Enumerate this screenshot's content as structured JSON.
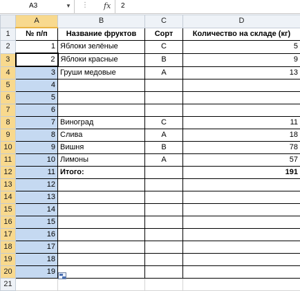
{
  "formula_bar": {
    "name_box": "A3",
    "fx": "fx",
    "formula": "2"
  },
  "columns": [
    "A",
    "B",
    "C",
    "D"
  ],
  "rows": [
    {
      "num": "1",
      "a": "№ п/п",
      "b": "Название фруктов",
      "c": "Сорт",
      "d": "Количество на складе (кг)"
    },
    {
      "num": "2",
      "a": "1",
      "b": "Яблоки зелёные",
      "c": "C",
      "d": "5"
    },
    {
      "num": "3",
      "a": "2",
      "b": "Яблоки красные",
      "c": "B",
      "d": "9"
    },
    {
      "num": "4",
      "a": "3",
      "b": "Груши медовые",
      "c": "A",
      "d": "13"
    },
    {
      "num": "5",
      "a": "4",
      "b": "",
      "c": "",
      "d": ""
    },
    {
      "num": "6",
      "a": "5",
      "b": "",
      "c": "",
      "d": ""
    },
    {
      "num": "7",
      "a": "6",
      "b": "",
      "c": "",
      "d": ""
    },
    {
      "num": "8",
      "a": "7",
      "b": "Виноград",
      "c": "C",
      "d": "11"
    },
    {
      "num": "9",
      "a": "8",
      "b": "Слива",
      "c": "A",
      "d": "18"
    },
    {
      "num": "10",
      "a": "9",
      "b": "Вишня",
      "c": "B",
      "d": "78"
    },
    {
      "num": "11",
      "a": "10",
      "b": "Лимоны",
      "c": "A",
      "d": "57"
    },
    {
      "num": "12",
      "a": "11",
      "b": "Итого:",
      "c": "",
      "d": "191"
    },
    {
      "num": "13",
      "a": "12",
      "b": "",
      "c": "",
      "d": ""
    },
    {
      "num": "14",
      "a": "13",
      "b": "",
      "c": "",
      "d": ""
    },
    {
      "num": "15",
      "a": "14",
      "b": "",
      "c": "",
      "d": ""
    },
    {
      "num": "16",
      "a": "15",
      "b": "",
      "c": "",
      "d": ""
    },
    {
      "num": "17",
      "a": "16",
      "b": "",
      "c": "",
      "d": ""
    },
    {
      "num": "18",
      "a": "17",
      "b": "",
      "c": "",
      "d": ""
    },
    {
      "num": "19",
      "a": "18",
      "b": "",
      "c": "",
      "d": ""
    },
    {
      "num": "20",
      "a": "19",
      "b": "",
      "c": "",
      "d": ""
    },
    {
      "num": "21",
      "a": "",
      "b": "",
      "c": "",
      "d": ""
    }
  ]
}
